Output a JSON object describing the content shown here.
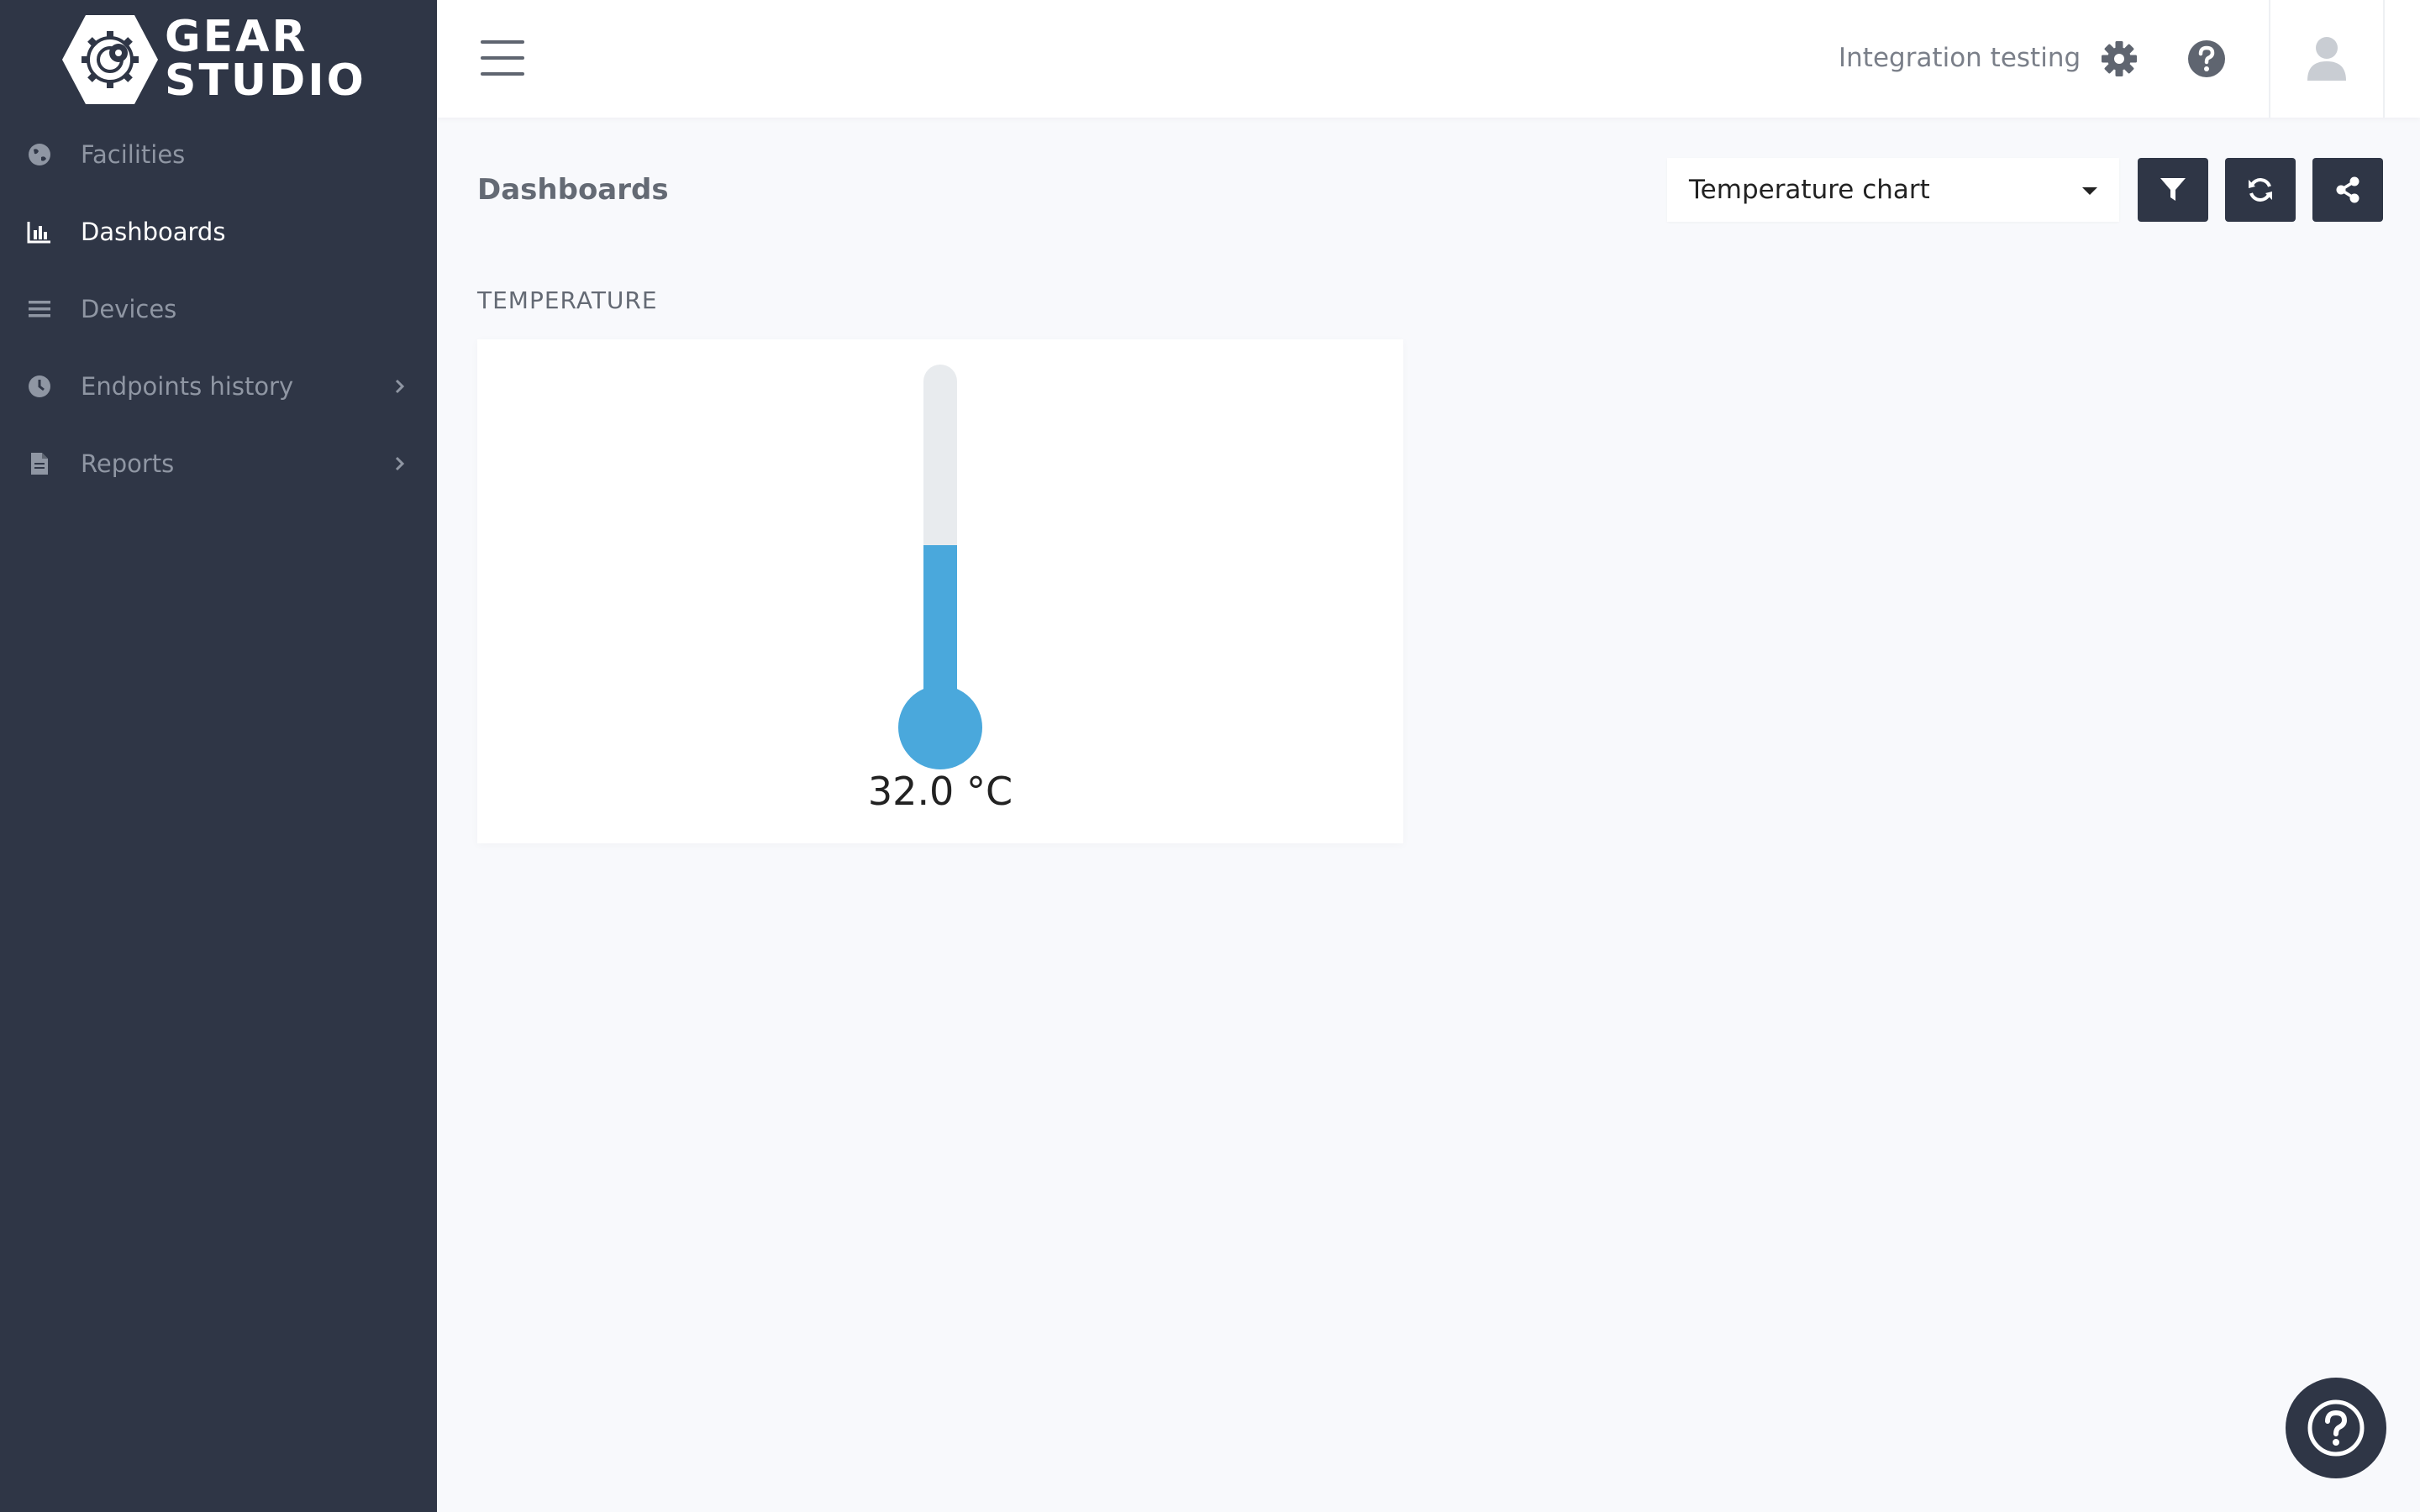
{
  "brand": {
    "line1": "GEAR",
    "line2": "STUDIO"
  },
  "sidebar": {
    "items": [
      {
        "label": "Facilities",
        "icon": "globe-icon",
        "active": false,
        "chevron": false
      },
      {
        "label": "Dashboards",
        "icon": "bar-chart-icon",
        "active": true,
        "chevron": false
      },
      {
        "label": "Devices",
        "icon": "list-icon",
        "active": false,
        "chevron": false
      },
      {
        "label": "Endpoints history",
        "icon": "clock-icon",
        "active": false,
        "chevron": true
      },
      {
        "label": "Reports",
        "icon": "file-icon",
        "active": false,
        "chevron": true
      }
    ]
  },
  "header": {
    "org_name": "Integration testing",
    "icons": [
      "menu-icon",
      "gear-icon",
      "help-icon",
      "user-icon"
    ]
  },
  "main": {
    "title": "Dashboards",
    "dashboard_select": {
      "value": "Temperature chart"
    },
    "toolbar_icons": [
      "filter-icon",
      "refresh-icon",
      "share-icon"
    ],
    "section_title": "TEMPERATURE",
    "widget": {
      "value_text": "32.0 °C",
      "fill_fraction": 0.5
    }
  },
  "colors": {
    "sidebar": "#2f3646",
    "accent": "#4aa8dc",
    "tube": "#e8ebee"
  }
}
